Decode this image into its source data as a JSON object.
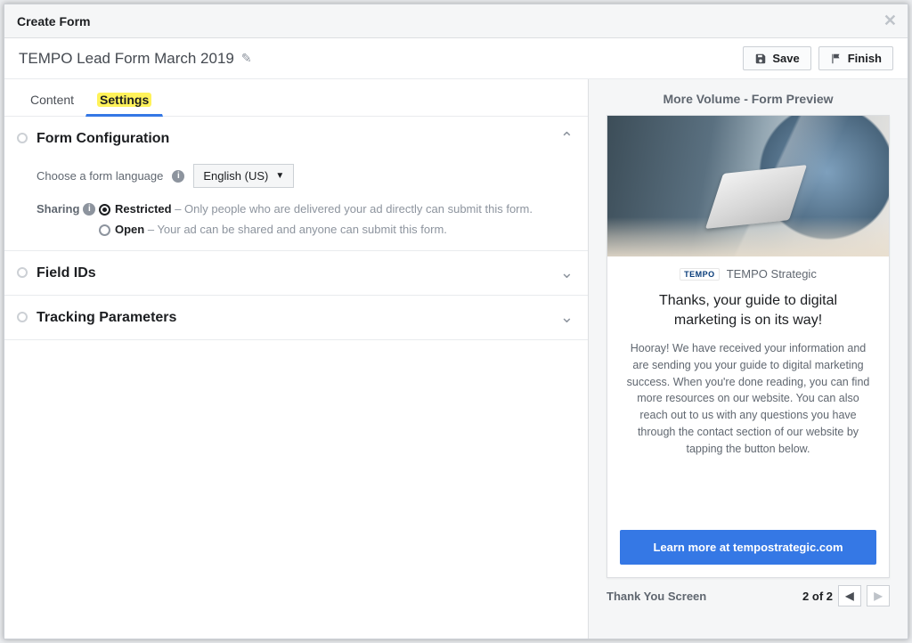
{
  "modal": {
    "title": "Create Form"
  },
  "form": {
    "name": "TEMPO Lead Form March 2019"
  },
  "actions": {
    "save": "Save",
    "finish": "Finish"
  },
  "tabs": {
    "content": "Content",
    "settings": "Settings",
    "active": "settings"
  },
  "sections": {
    "config": {
      "title": "Form Configuration",
      "expanded": true,
      "language_label": "Choose a form language",
      "language_value": "English (US)",
      "sharing_label": "Sharing",
      "options": {
        "restricted": {
          "name": "Restricted",
          "desc": " – Only people who are delivered your ad directly can submit this form."
        },
        "open": {
          "name": "Open",
          "desc": " – Your ad can be shared and anyone can submit this form."
        }
      },
      "selected": "restricted"
    },
    "fieldids": {
      "title": "Field IDs",
      "expanded": false
    },
    "tracking": {
      "title": "Tracking Parameters",
      "expanded": false
    }
  },
  "preview": {
    "header": "More Volume - Form Preview",
    "brand_logo_text": "TEMPO",
    "brand_name": "TEMPO Strategic",
    "headline": "Thanks, your guide to digital marketing is on its way!",
    "body": "Hooray! We have received your information and are sending you your guide to digital marketing success. When you're done reading, you can find more resources on our website. You can also reach out to us with any questions you have through the contact section of our website by tapping the button below.",
    "cta": "Learn more at tempostrategic.com",
    "footer_label": "Thank You Screen",
    "page_current": 2,
    "page_total": 2
  }
}
